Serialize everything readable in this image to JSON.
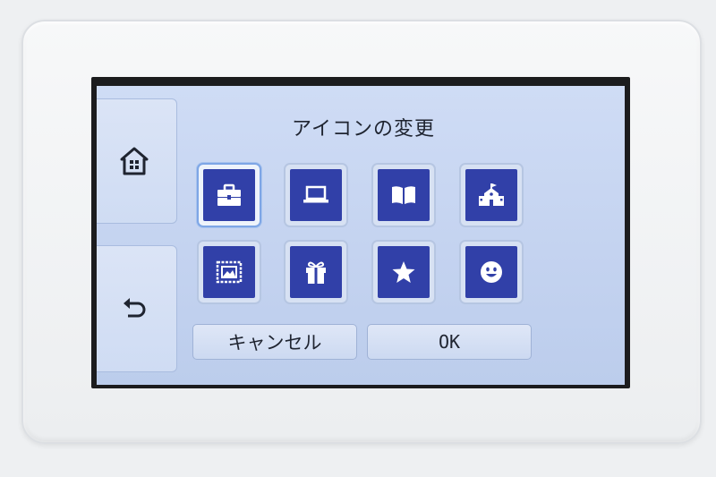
{
  "dialog": {
    "title": "アイコンの変更"
  },
  "sidebar": {
    "items": [
      {
        "name": "home",
        "icon": "home-icon"
      },
      {
        "name": "back",
        "icon": "back-arrow-icon"
      }
    ]
  },
  "icon_grid": {
    "selected_index": 0,
    "icons": [
      {
        "icon": "briefcase-icon"
      },
      {
        "icon": "laptop-icon"
      },
      {
        "icon": "book-icon"
      },
      {
        "icon": "school-icon"
      },
      {
        "icon": "picture-icon"
      },
      {
        "icon": "gift-icon"
      },
      {
        "icon": "star-icon"
      },
      {
        "icon": "smiley-icon"
      }
    ]
  },
  "buttons": {
    "cancel_label": "キャンセル",
    "ok_label": "OK"
  },
  "colors": {
    "icon_background": "#3140a8",
    "screen_background": "#c9d7f2",
    "selected_border": "#7ea6e6"
  }
}
